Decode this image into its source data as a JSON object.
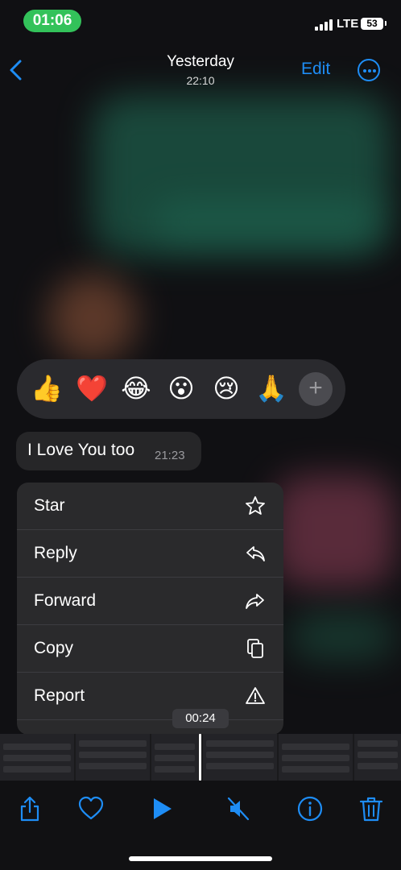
{
  "status_bar": {
    "time": "01:06",
    "network": "LTE",
    "battery": "53"
  },
  "nav": {
    "title": "Yesterday",
    "subtitle": "22:10",
    "edit_label": "Edit"
  },
  "reactions": [
    "👍",
    "❤️",
    "😂",
    "😮",
    "😢",
    "🙏"
  ],
  "message": {
    "text": "I Love You too",
    "time": "21:23"
  },
  "context_menu": {
    "items": [
      {
        "label": "Star",
        "icon": "star-icon"
      },
      {
        "label": "Reply",
        "icon": "reply-icon"
      },
      {
        "label": "Forward",
        "icon": "forward-icon"
      },
      {
        "label": "Copy",
        "icon": "copy-icon"
      },
      {
        "label": "Report",
        "icon": "warning-icon"
      }
    ]
  },
  "video": {
    "duration": "00:24"
  },
  "toolbar": {
    "icons": [
      "share-icon",
      "heart-icon",
      "play-icon",
      "mute-icon",
      "info-icon",
      "trash-icon"
    ]
  },
  "colors": {
    "accent": "#1e8df5",
    "status_pill": "#33c25a",
    "menu_bg": "#2a2a2c"
  }
}
